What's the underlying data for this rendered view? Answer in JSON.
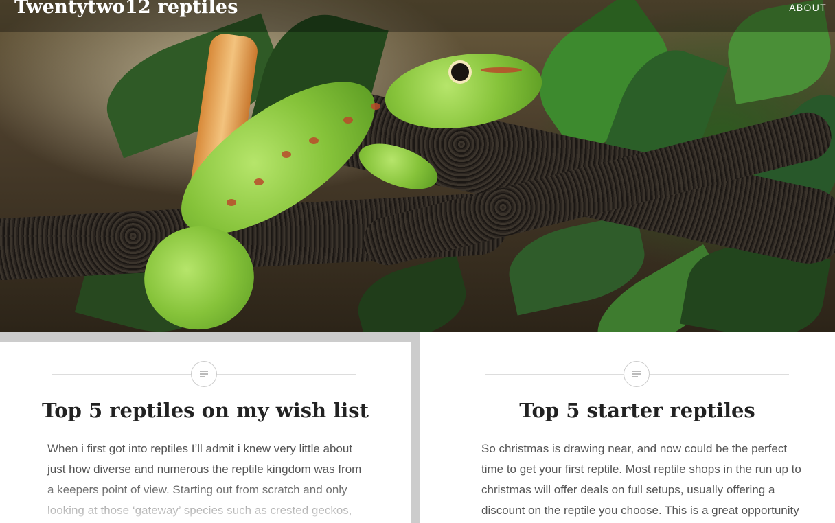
{
  "site": {
    "title": "Twentytwo12 reptiles"
  },
  "nav": {
    "about_label": "ABOUT"
  },
  "hero": {
    "icon": "gecko-photo"
  },
  "posts": [
    {
      "title": "Top 5 reptiles on my wish list",
      "excerpt": "When i first got into reptiles I’ll admit i knew very little about just how diverse and numerous the reptile kingdom was from a keepers point of view. Starting out from scratch and only looking at those ‘gateway’ species such as crested geckos,",
      "format_icon": "standard-post-icon"
    },
    {
      "title": "Top 5 starter reptiles",
      "excerpt": "So christmas is drawing near, and now could be the perfect time to get your first reptile. Most reptile shops in the run up to christmas will offer deals on full setups, usually offering a discount on the reptile you choose. This is a great opportunity",
      "format_icon": "standard-post-icon"
    }
  ]
}
